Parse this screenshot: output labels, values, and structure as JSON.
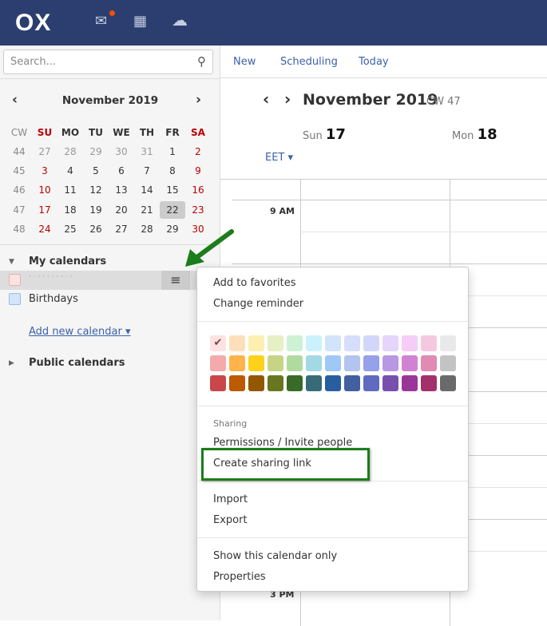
{
  "topbar": {
    "logo": "OX",
    "icons": [
      "mail-icon",
      "calendar-icon",
      "cloud-icon"
    ],
    "notification_color": "#f0500a",
    "bg": "#2c3e70"
  },
  "sidebar": {
    "search_placeholder": "Search...",
    "minical": {
      "title": "November 2019",
      "headers": [
        "CW",
        "SU",
        "MO",
        "TU",
        "WE",
        "TH",
        "FR",
        "SA"
      ],
      "weeks": [
        {
          "cw": "44",
          "days": [
            "27",
            "28",
            "29",
            "30",
            "31",
            "1",
            "2"
          ]
        },
        {
          "cw": "45",
          "days": [
            "3",
            "4",
            "5",
            "6",
            "7",
            "8",
            "9"
          ]
        },
        {
          "cw": "46",
          "days": [
            "10",
            "11",
            "12",
            "13",
            "14",
            "15",
            "16"
          ]
        },
        {
          "cw": "47",
          "days": [
            "17",
            "18",
            "19",
            "20",
            "21",
            "22",
            "23"
          ]
        },
        {
          "cw": "48",
          "days": [
            "24",
            "25",
            "26",
            "27",
            "28",
            "29",
            "30"
          ]
        }
      ],
      "selected": "22"
    },
    "my_calendars": "My calendars",
    "calendars": [
      {
        "label": "· · · · · · · · · ·",
        "color": "#fde2e2"
      },
      {
        "label": "Birthdays",
        "color": "#d3e5fb"
      }
    ],
    "add_calendar": "Add new calendar",
    "public_calendars": "Public calendars"
  },
  "toolbar": {
    "new": "New",
    "scheduling": "Scheduling",
    "today": "Today"
  },
  "main": {
    "title": "November 2019",
    "cw": "CW 47",
    "days": [
      {
        "dow": "Sun",
        "num": "17"
      },
      {
        "dow": "Mon",
        "num": "18"
      }
    ],
    "timezone": "EET",
    "times": [
      "9 AM",
      "3 PM"
    ]
  },
  "menu": {
    "items1": [
      "Add to favorites",
      "Change reminder"
    ],
    "colors": [
      [
        "#fde2e2",
        "#fde0b9",
        "#fdefb0",
        "#e7efc4",
        "#ccf2d4",
        "#cbf2fc",
        "#d2e4fb",
        "#d6defb",
        "#d3d6fb",
        "#e5d5fb",
        "#f6cdf7",
        "#f6c8e0",
        "#e9e9e9"
      ],
      [
        "#f4aaaa",
        "#ffb34a",
        "#ffd11b",
        "#c6d486",
        "#afdc9e",
        "#a3d9e4",
        "#9fc8f6",
        "#b3c4ee",
        "#97a0ea",
        "#b998e3",
        "#d282d2",
        "#e08ab4",
        "#c3c3c3"
      ],
      [
        "#c9474a",
        "#bb5a00",
        "#935700",
        "#667720",
        "#386b27",
        "#386b78",
        "#285e9f",
        "#425f9f",
        "#5f6bbf",
        "#7750ae",
        "#9b3699",
        "#a3306a",
        "#6a6a6a"
      ]
    ],
    "selected_color": "#fde2e2",
    "sharing_header": "Sharing",
    "sharing": [
      "Permissions / Invite people",
      "Create sharing link"
    ],
    "items3": [
      "Import",
      "Export"
    ],
    "items4": [
      "Show this calendar only",
      "Properties"
    ]
  },
  "annotation": {
    "arrow_color": "#1b7d1b"
  }
}
